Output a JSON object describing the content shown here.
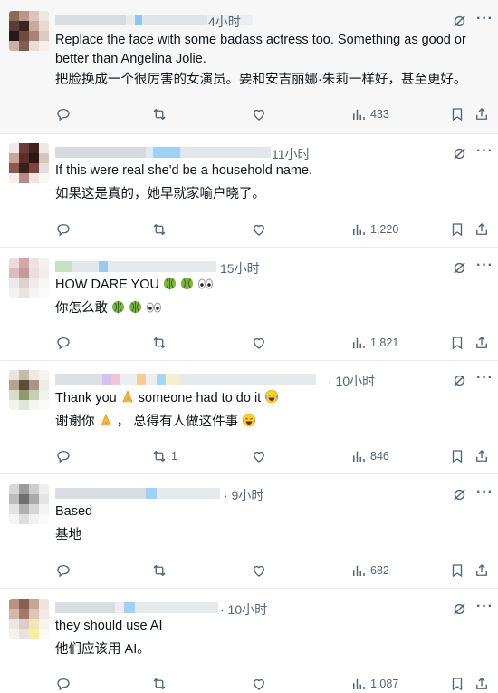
{
  "replies": [
    {
      "time": "4小时",
      "line1": "Replace the face with some badass actress too. Something as good or",
      "line2": "better than Angelina Jolie.",
      "line3": "把脸换成一个很厉害的女演员。要和安吉丽娜·朱莉一样好，甚至更好。",
      "retweets": "",
      "views": "433"
    },
    {
      "time": "11小时",
      "line1": "If this were real she'd be a household name.",
      "line2": "如果这是真的，她早就家喻户晓了。",
      "retweets": "",
      "views": "1,220"
    },
    {
      "time": "15小时",
      "line1": "HOW DARE YOU",
      "line2": "你怎么敢",
      "retweets": "",
      "views": "1,821"
    },
    {
      "time": "· 10小时",
      "line1a": "Thank you",
      "line1b": "someone had to do it",
      "line2a": "谢谢你",
      "line2b": "，  总得有人做这件事",
      "retweets": "1",
      "views": "846"
    },
    {
      "time": "· 9小时",
      "line1": "Based",
      "line2": "基地",
      "retweets": "",
      "views": "682"
    },
    {
      "time": "· 10小时",
      "line1": "they should use AI",
      "line2": "他们应该用 AI。",
      "retweets": "",
      "views": "1,087"
    }
  ],
  "icons": {
    "reply": "reply-icon",
    "retweet": "retweet-icon",
    "like": "like-icon",
    "views": "views-icon",
    "bookmark": "bookmark-icon",
    "share": "share-icon",
    "grok": "grok-icon",
    "more": "more-icon"
  },
  "colors": {
    "text": "#0f1419",
    "muted": "#536471",
    "divider": "#e6ecf0",
    "highlight_bg": "#f7f7f7"
  }
}
